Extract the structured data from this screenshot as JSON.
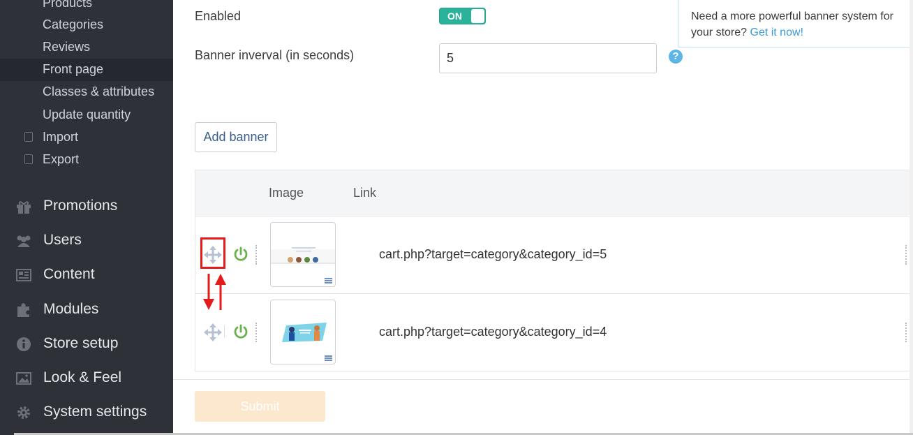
{
  "sidebar": {
    "subitems": [
      {
        "label": "Products"
      },
      {
        "label": "Categories"
      },
      {
        "label": "Reviews"
      },
      {
        "label": "Front page"
      },
      {
        "label": "Classes & attributes"
      },
      {
        "label": "Update quantity"
      },
      {
        "label": "Import"
      },
      {
        "label": "Export"
      }
    ],
    "nav": [
      {
        "label": "Promotions",
        "icon": "gift-icon"
      },
      {
        "label": "Users",
        "icon": "users-icon"
      },
      {
        "label": "Content",
        "icon": "newspaper-icon"
      },
      {
        "label": "Modules",
        "icon": "puzzle-icon"
      },
      {
        "label": "Store setup",
        "icon": "info-icon"
      },
      {
        "label": "Look & Feel",
        "icon": "picture-icon"
      },
      {
        "label": "System settings",
        "icon": "gear-icon"
      }
    ]
  },
  "form": {
    "enabled_label": "Enabled",
    "toggle_text": "ON",
    "interval_label": "Banner inverval (in seconds)",
    "interval_value": "5",
    "help_glyph": "?",
    "add_banner": "Add banner",
    "submit": "Submit"
  },
  "promo": {
    "text": "Need a more powerful banner system for your store?",
    "link": "Get it now!"
  },
  "table": {
    "headers": {
      "image": "Image",
      "link": "Link"
    },
    "rows": [
      {
        "link": "cart.php?target=category&category_id=5"
      },
      {
        "link": "cart.php?target=category&category_id=4"
      }
    ]
  },
  "colors": {
    "sidebar_bg": "#2e3138",
    "toggle_on": "#2ab39a",
    "power_green": "#6ab04c",
    "highlight_red": "#e51a1a",
    "link_blue": "#3a9bd6"
  }
}
